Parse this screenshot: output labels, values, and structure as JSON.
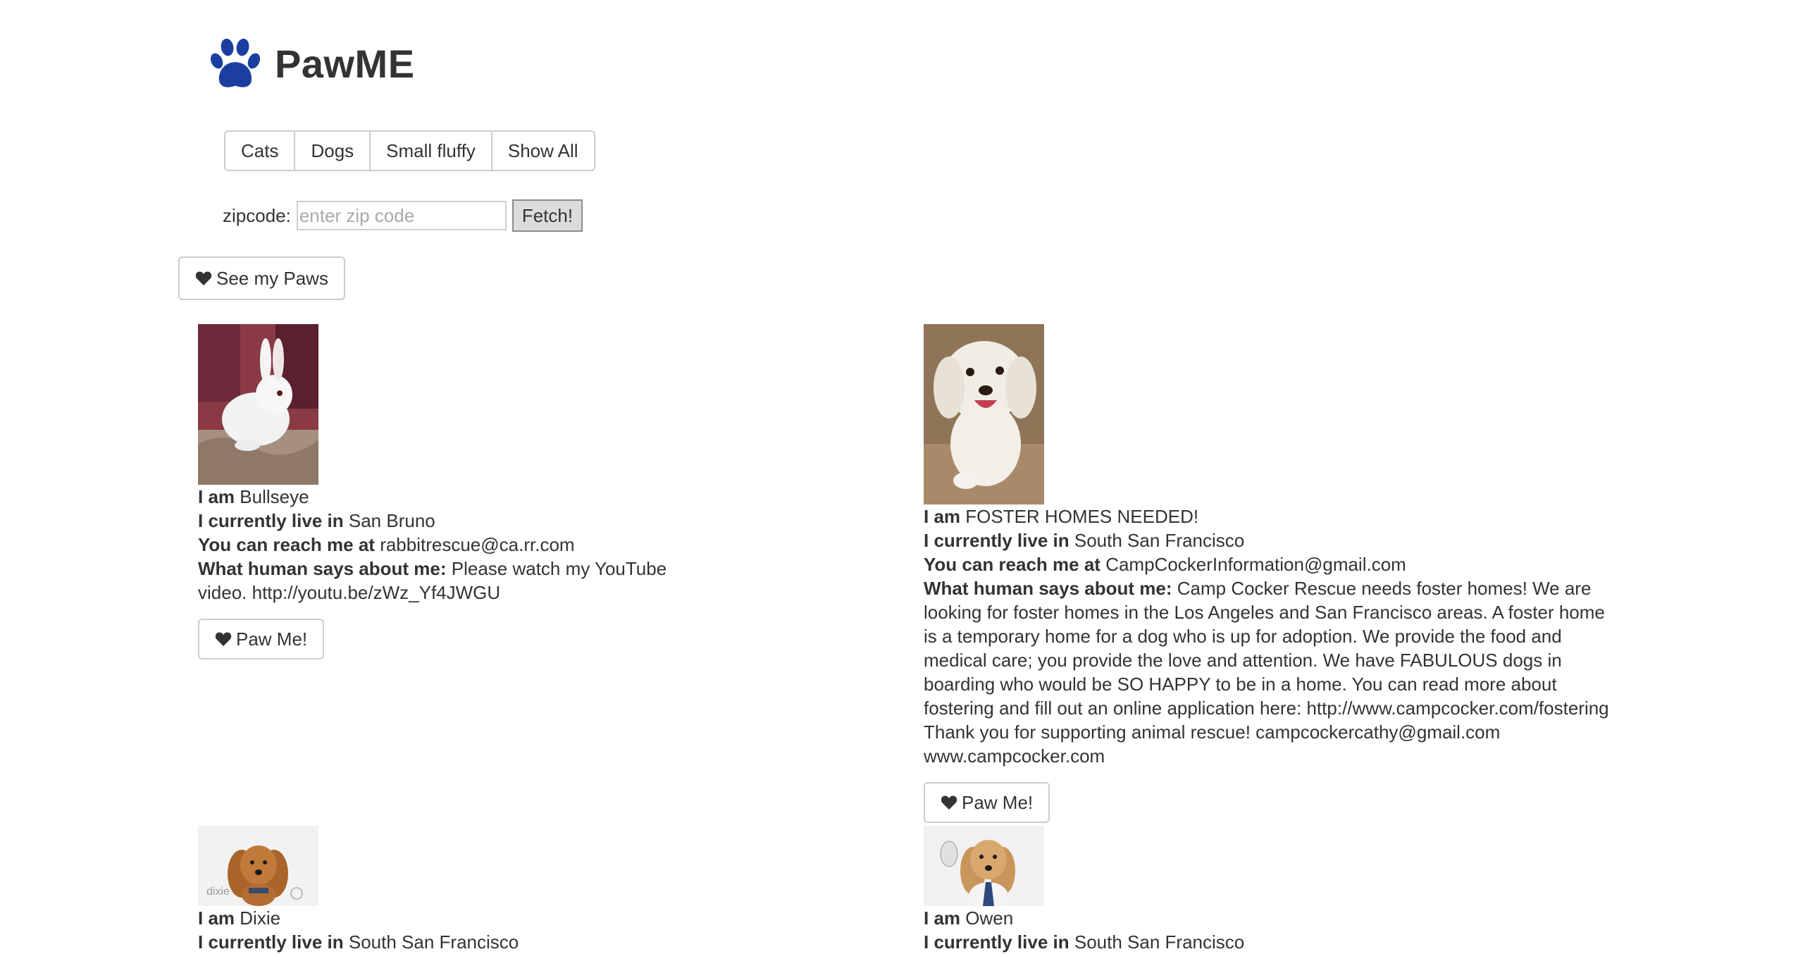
{
  "header": {
    "title": "PawME",
    "logo_icon": "paw-icon",
    "logo_color": "#1a3fa0"
  },
  "filters": [
    {
      "label": "Cats"
    },
    {
      "label": "Dogs"
    },
    {
      "label": "Small fluffy"
    },
    {
      "label": "Show All"
    }
  ],
  "zip": {
    "label": "zipcode:",
    "placeholder": "enter zip code",
    "value": "",
    "button_label": "Fetch!"
  },
  "see_paws": {
    "label": "See my Paws",
    "icon": "heart-icon"
  },
  "labels": {
    "name": "I am",
    "location": "I currently live in",
    "contact": "You can reach me at",
    "description": "What human says about me:",
    "paw_button": "Paw Me!"
  },
  "pets": [
    {
      "name": "Bullseye",
      "location": "San Bruno",
      "contact": "rabbitrescue@ca.rr.com",
      "description": "Please watch my YouTube video. http://youtu.be/zWz_Yf4JWGU",
      "photo": "white-rabbit-photo"
    },
    {
      "name": "FOSTER HOMES NEEDED!",
      "location": "South San Francisco",
      "contact": "CampCockerInformation@gmail.com",
      "description": "Camp Cocker Rescue needs foster homes! We are looking for foster homes in the Los Angeles and San Francisco areas. A foster home is a temporary home for a dog who is up for adoption. We provide the food and medical care; you provide the love and attention. We have FABULOUS dogs in boarding who would be SO HAPPY to be in a home. You can read more about fostering and fill out an online application here: http://www.campcocker.com/fostering Thank you for supporting animal rescue! campcockercathy@gmail.com www.campcocker.com",
      "photo": "white-dog-photo"
    },
    {
      "name": "Dixie",
      "location": "South San Francisco",
      "photo": "cocker-spaniel-photo",
      "photo_caption": "dixie"
    },
    {
      "name": "Owen",
      "location": "South San Francisco",
      "photo": "cocker-spaniel-tie-photo"
    }
  ]
}
